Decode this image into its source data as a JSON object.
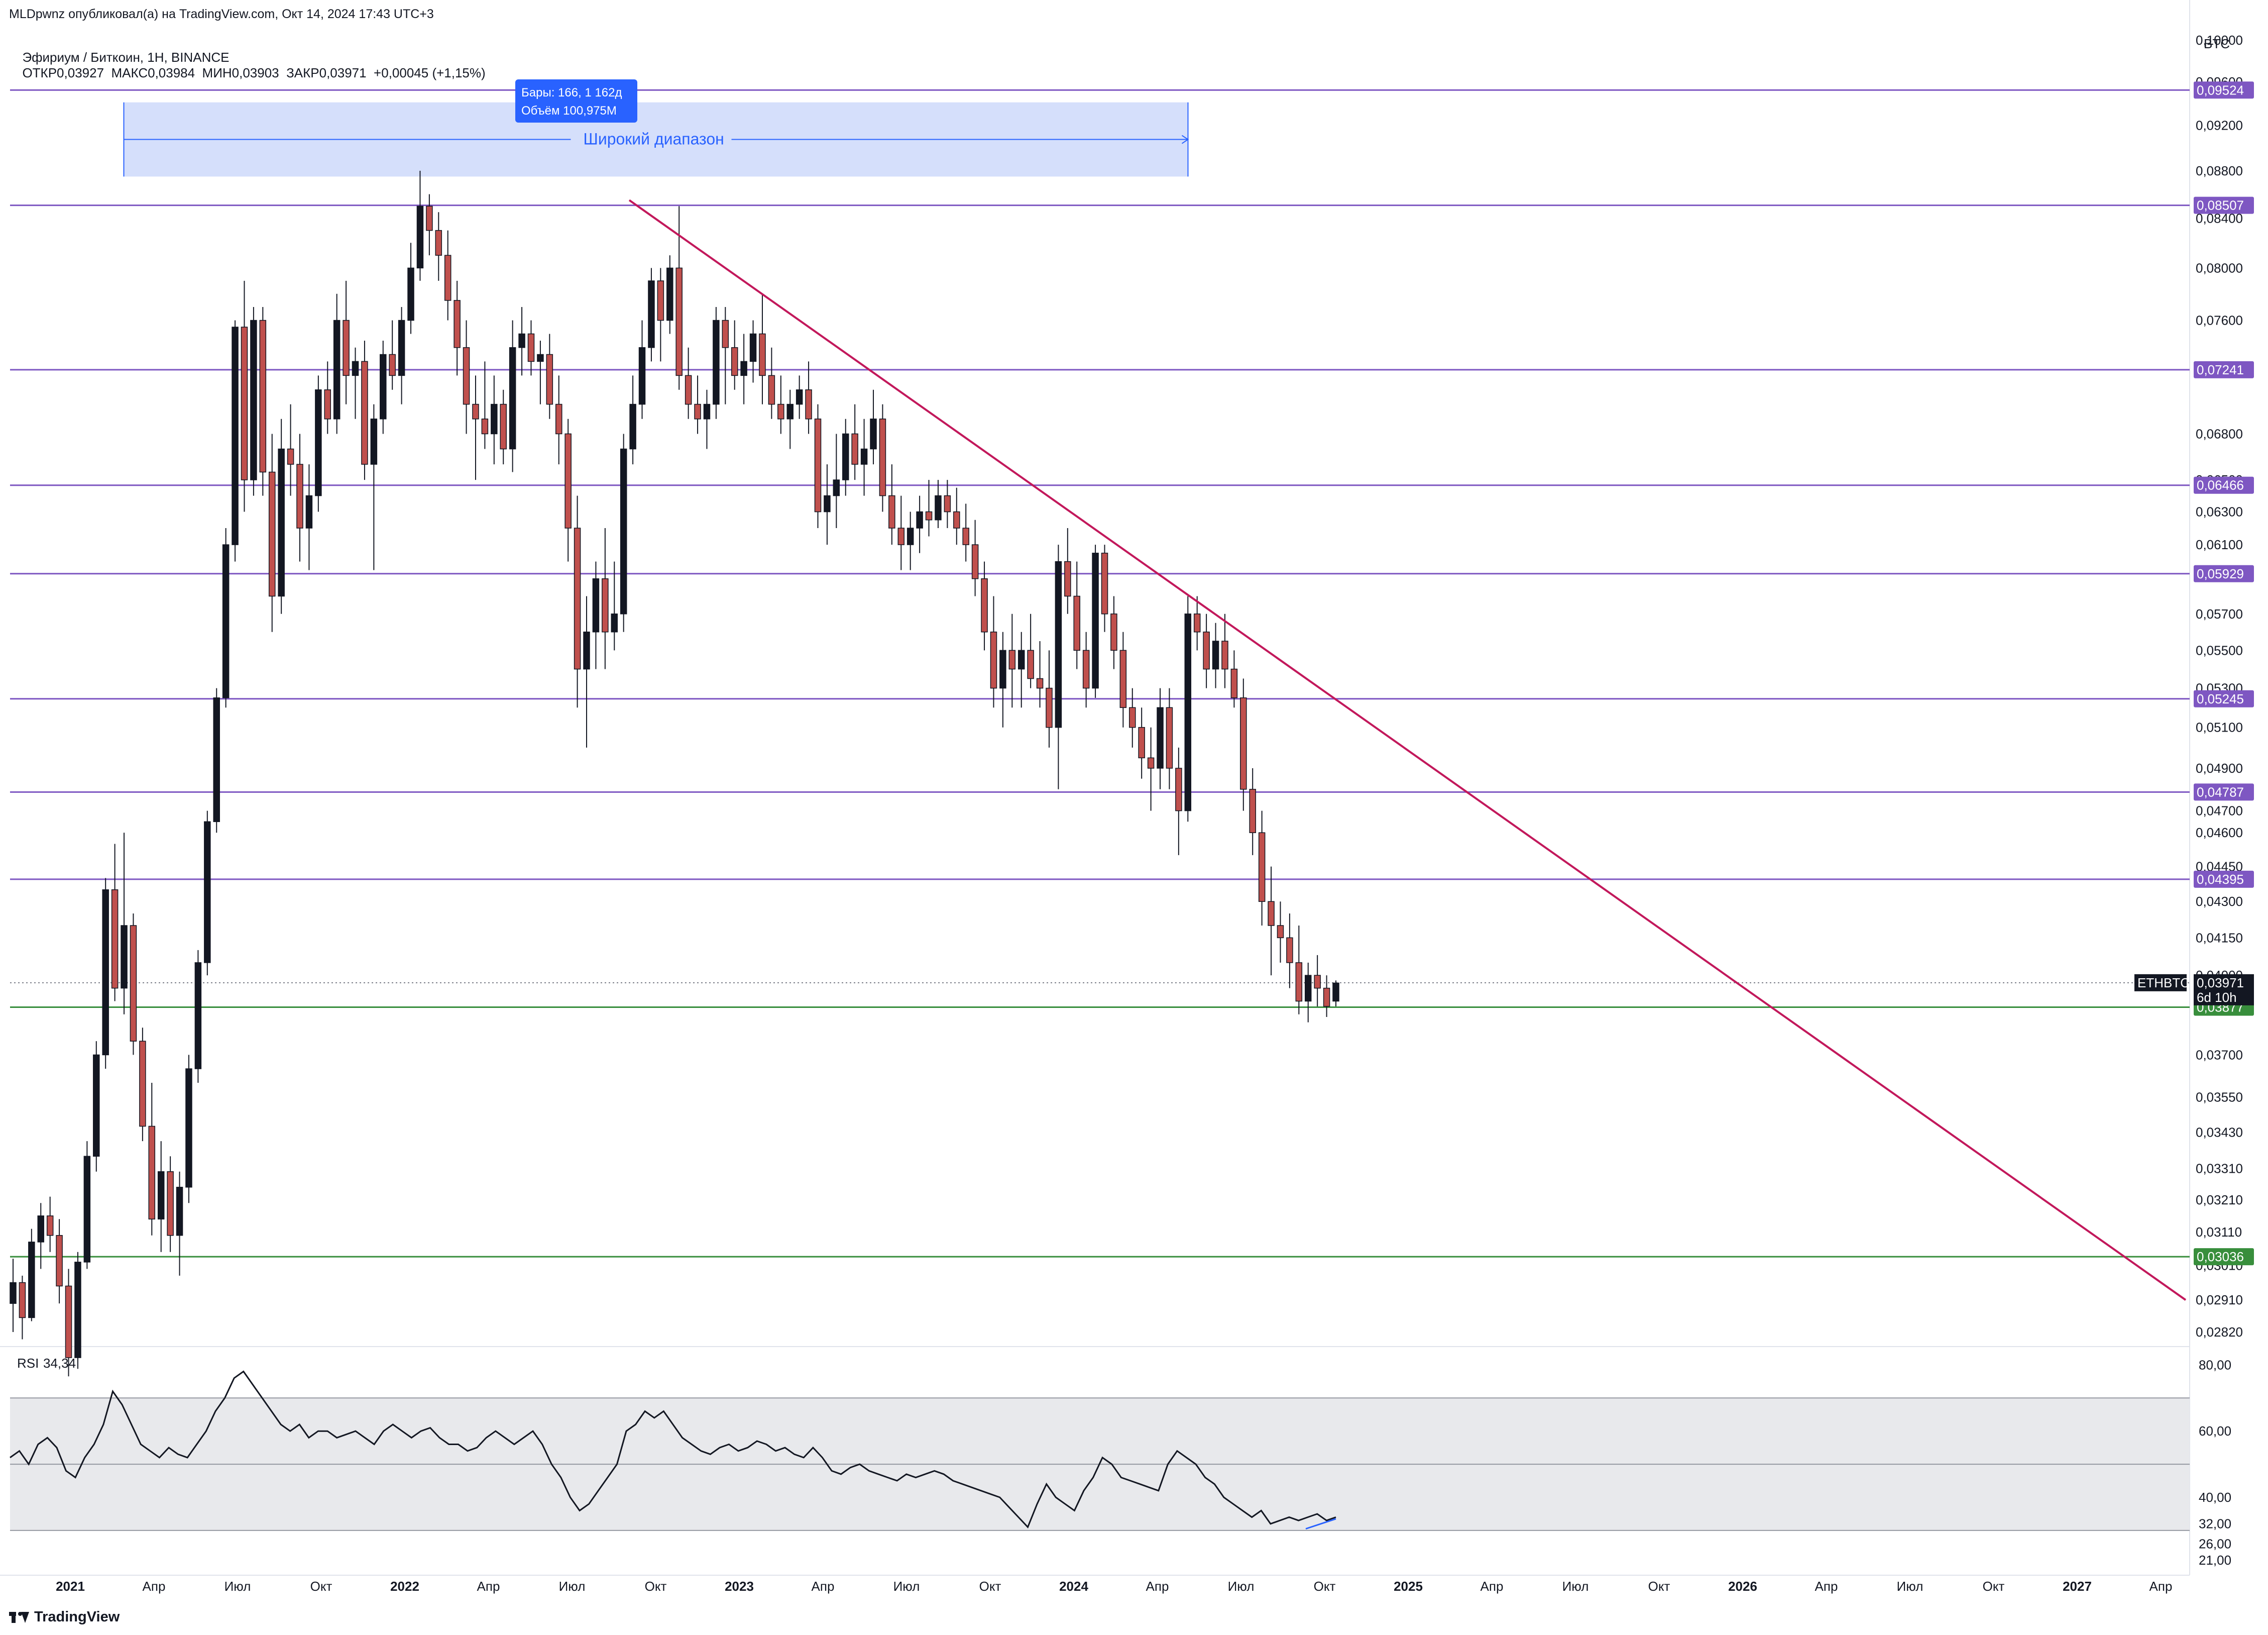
{
  "header": {
    "published": "MLDpwnz опубликовал(а) на TradingView.com, Окт 14, 2024 17:43 UTC+3"
  },
  "legend": {
    "symbol": "Эфириум / Биткоин, 1H, BINANCE",
    "ohlc": "ОТКР0,03927  МАКС0,03984  МИН0,03903  ЗАКР0,03971  +0,00045 (+1,15%)"
  },
  "currency": "BTC",
  "footer": {
    "logo_text": "TradingView"
  },
  "colors": {
    "up": "#131722",
    "down": "#c0504d",
    "purple": "#7e57c2",
    "green": "#388e3c",
    "trend": "#c2185b",
    "range_fill": "#d0dcfb",
    "range_box": "#2962ff"
  },
  "chart_data": {
    "type": "candlestick",
    "symbol": "ETHBTC",
    "price_axis": {
      "scale": "log",
      "ticks": [
        "0,10000",
        "0,09600",
        "0,09200",
        "0,08800",
        "0,08400",
        "0,08000",
        "0,07600",
        "0,06800",
        "0,06500",
        "0,06300",
        "0,06100",
        "0,05700",
        "0,05500",
        "0,05300",
        "0,05100",
        "0,04900",
        "0,04700",
        "0,04600",
        "0,04450",
        "0,04300",
        "0,04150",
        "0,04000",
        "0,03700",
        "0,03550",
        "0,03430",
        "0,03310",
        "0,03210",
        "0,03110",
        "0,03010",
        "0,02910",
        "0,02820"
      ],
      "range": [
        0.0278,
        0.102
      ]
    },
    "time_axis": {
      "labels": [
        "2021",
        "Апр",
        "Июл",
        "Окт",
        "2022",
        "Апр",
        "Июл",
        "Окт",
        "2023",
        "Апр",
        "Июл",
        "Окт",
        "2024",
        "Апр",
        "Июл",
        "Окт",
        "2025",
        "Апр",
        "Июл",
        "Окт",
        "2026",
        "Апр",
        "Июл",
        "Окт",
        "2027",
        "Апр"
      ],
      "bold": [
        "2021",
        "2022",
        "2023",
        "2024",
        "2025",
        "2026",
        "2027"
      ]
    },
    "horizontal_levels": [
      {
        "price": 0.09524,
        "label": "0,09524",
        "color": "purple"
      },
      {
        "price": 0.08507,
        "label": "0,08507",
        "color": "purple"
      },
      {
        "price": 0.07241,
        "label": "0,07241",
        "color": "purple"
      },
      {
        "price": 0.06466,
        "label": "0,06466",
        "color": "purple"
      },
      {
        "price": 0.05929,
        "label": "0,05929",
        "color": "purple"
      },
      {
        "price": 0.05245,
        "label": "0,05245",
        "color": "purple"
      },
      {
        "price": 0.04787,
        "label": "0,04787",
        "color": "purple"
      },
      {
        "price": 0.04395,
        "label": "0,04395",
        "color": "purple"
      },
      {
        "price": 0.03877,
        "label": "0,03877",
        "color": "green"
      },
      {
        "price": 0.03036,
        "label": "0,03036",
        "color": "green"
      }
    ],
    "last_price": {
      "symbol": "ETHBTC",
      "price": "0,03971",
      "countdown": "6d 10h",
      "value": 0.03971
    },
    "trendline": {
      "from": {
        "time": "2022-09",
        "price": 0.0855
      },
      "to": {
        "time": "2027-05",
        "price": 0.0291
      }
    },
    "range_tool": {
      "label": "Широкий диапазон",
      "bars": "Бары: 166, 1 162д",
      "volume": "Объём 100,975M",
      "from_time": "2021-03",
      "to_time": "2024-05",
      "price_high": 0.0941,
      "price_low": 0.0875
    },
    "candles_weekly": [
      [
        0.029,
        0.0303,
        0.0282,
        0.0296
      ],
      [
        0.0296,
        0.0298,
        0.028,
        0.0286
      ],
      [
        0.0286,
        0.0312,
        0.0285,
        0.0308
      ],
      [
        0.0308,
        0.032,
        0.03,
        0.0316
      ],
      [
        0.0316,
        0.0322,
        0.0305,
        0.031
      ],
      [
        0.031,
        0.0315,
        0.029,
        0.0295
      ],
      [
        0.0295,
        0.03,
        0.027,
        0.0275
      ],
      [
        0.0275,
        0.0305,
        0.0272,
        0.0302
      ],
      [
        0.0302,
        0.034,
        0.03,
        0.0335
      ],
      [
        0.0335,
        0.0375,
        0.033,
        0.037
      ],
      [
        0.037,
        0.044,
        0.0365,
        0.0435
      ],
      [
        0.0435,
        0.0455,
        0.039,
        0.0395
      ],
      [
        0.0395,
        0.046,
        0.0385,
        0.042
      ],
      [
        0.042,
        0.0425,
        0.037,
        0.0375
      ],
      [
        0.0375,
        0.038,
        0.034,
        0.0345
      ],
      [
        0.0345,
        0.036,
        0.031,
        0.0315
      ],
      [
        0.0315,
        0.034,
        0.0305,
        0.033
      ],
      [
        0.033,
        0.0335,
        0.0305,
        0.031
      ],
      [
        0.031,
        0.033,
        0.0298,
        0.0325
      ],
      [
        0.0325,
        0.037,
        0.032,
        0.0365
      ],
      [
        0.0365,
        0.041,
        0.036,
        0.0405
      ],
      [
        0.0405,
        0.047,
        0.04,
        0.0465
      ],
      [
        0.0465,
        0.053,
        0.046,
        0.0525
      ],
      [
        0.0525,
        0.062,
        0.052,
        0.061
      ],
      [
        0.061,
        0.076,
        0.06,
        0.0755
      ],
      [
        0.0755,
        0.079,
        0.063,
        0.065
      ],
      [
        0.065,
        0.077,
        0.064,
        0.076
      ],
      [
        0.076,
        0.077,
        0.064,
        0.0655
      ],
      [
        0.0655,
        0.068,
        0.056,
        0.058
      ],
      [
        0.058,
        0.069,
        0.057,
        0.067
      ],
      [
        0.067,
        0.07,
        0.064,
        0.066
      ],
      [
        0.066,
        0.068,
        0.06,
        0.062
      ],
      [
        0.062,
        0.066,
        0.0595,
        0.064
      ],
      [
        0.064,
        0.072,
        0.063,
        0.071
      ],
      [
        0.071,
        0.073,
        0.068,
        0.069
      ],
      [
        0.069,
        0.078,
        0.068,
        0.076
      ],
      [
        0.076,
        0.079,
        0.07,
        0.072
      ],
      [
        0.072,
        0.074,
        0.069,
        0.073
      ],
      [
        0.073,
        0.0745,
        0.065,
        0.066
      ],
      [
        0.066,
        0.07,
        0.0595,
        0.069
      ],
      [
        0.069,
        0.0745,
        0.068,
        0.0735
      ],
      [
        0.0735,
        0.076,
        0.071,
        0.072
      ],
      [
        0.072,
        0.077,
        0.07,
        0.076
      ],
      [
        0.076,
        0.082,
        0.075,
        0.08
      ],
      [
        0.08,
        0.088,
        0.079,
        0.085
      ],
      [
        0.085,
        0.086,
        0.081,
        0.083
      ],
      [
        0.083,
        0.0845,
        0.079,
        0.081
      ],
      [
        0.081,
        0.083,
        0.076,
        0.0775
      ],
      [
        0.0775,
        0.079,
        0.072,
        0.074
      ],
      [
        0.074,
        0.076,
        0.068,
        0.07
      ],
      [
        0.07,
        0.072,
        0.065,
        0.069
      ],
      [
        0.069,
        0.073,
        0.067,
        0.068
      ],
      [
        0.068,
        0.072,
        0.066,
        0.07
      ],
      [
        0.07,
        0.071,
        0.066,
        0.067
      ],
      [
        0.067,
        0.076,
        0.0655,
        0.074
      ],
      [
        0.074,
        0.077,
        0.072,
        0.075
      ],
      [
        0.075,
        0.076,
        0.072,
        0.073
      ],
      [
        0.073,
        0.0745,
        0.07,
        0.0735
      ],
      [
        0.0735,
        0.075,
        0.069,
        0.07
      ],
      [
        0.07,
        0.072,
        0.066,
        0.068
      ],
      [
        0.068,
        0.069,
        0.06,
        0.062
      ],
      [
        0.062,
        0.064,
        0.052,
        0.054
      ],
      [
        0.054,
        0.058,
        0.05,
        0.056
      ],
      [
        0.056,
        0.06,
        0.054,
        0.059
      ],
      [
        0.059,
        0.062,
        0.054,
        0.056
      ],
      [
        0.056,
        0.06,
        0.055,
        0.057
      ],
      [
        0.057,
        0.068,
        0.056,
        0.067
      ],
      [
        0.067,
        0.072,
        0.066,
        0.07
      ],
      [
        0.07,
        0.076,
        0.069,
        0.074
      ],
      [
        0.074,
        0.08,
        0.073,
        0.079
      ],
      [
        0.079,
        0.08,
        0.073,
        0.076
      ],
      [
        0.076,
        0.081,
        0.075,
        0.08
      ],
      [
        0.08,
        0.085,
        0.071,
        0.072
      ],
      [
        0.072,
        0.074,
        0.069,
        0.07
      ],
      [
        0.07,
        0.072,
        0.068,
        0.069
      ],
      [
        0.069,
        0.071,
        0.067,
        0.07
      ],
      [
        0.07,
        0.077,
        0.069,
        0.076
      ],
      [
        0.076,
        0.077,
        0.07,
        0.074
      ],
      [
        0.074,
        0.076,
        0.071,
        0.072
      ],
      [
        0.072,
        0.075,
        0.07,
        0.073
      ],
      [
        0.073,
        0.076,
        0.0715,
        0.075
      ],
      [
        0.075,
        0.078,
        0.07,
        0.072
      ],
      [
        0.072,
        0.074,
        0.069,
        0.07
      ],
      [
        0.07,
        0.072,
        0.068,
        0.069
      ],
      [
        0.069,
        0.071,
        0.067,
        0.07
      ],
      [
        0.07,
        0.072,
        0.069,
        0.071
      ],
      [
        0.071,
        0.073,
        0.068,
        0.069
      ],
      [
        0.069,
        0.07,
        0.062,
        0.063
      ],
      [
        0.063,
        0.066,
        0.061,
        0.064
      ],
      [
        0.064,
        0.068,
        0.062,
        0.065
      ],
      [
        0.065,
        0.069,
        0.064,
        0.068
      ],
      [
        0.068,
        0.07,
        0.065,
        0.066
      ],
      [
        0.066,
        0.069,
        0.064,
        0.067
      ],
      [
        0.067,
        0.071,
        0.066,
        0.069
      ],
      [
        0.069,
        0.07,
        0.063,
        0.064
      ],
      [
        0.064,
        0.066,
        0.061,
        0.062
      ],
      [
        0.062,
        0.064,
        0.0595,
        0.061
      ],
      [
        0.061,
        0.063,
        0.0595,
        0.062
      ],
      [
        0.062,
        0.064,
        0.0605,
        0.063
      ],
      [
        0.063,
        0.065,
        0.0615,
        0.0625
      ],
      [
        0.0625,
        0.065,
        0.062,
        0.064
      ],
      [
        0.064,
        0.065,
        0.062,
        0.063
      ],
      [
        0.063,
        0.0645,
        0.061,
        0.062
      ],
      [
        0.062,
        0.0635,
        0.06,
        0.061
      ],
      [
        0.061,
        0.0625,
        0.058,
        0.059
      ],
      [
        0.059,
        0.06,
        0.055,
        0.056
      ],
      [
        0.056,
        0.058,
        0.052,
        0.053
      ],
      [
        0.053,
        0.056,
        0.051,
        0.055
      ],
      [
        0.055,
        0.057,
        0.052,
        0.054
      ],
      [
        0.054,
        0.056,
        0.052,
        0.055
      ],
      [
        0.055,
        0.057,
        0.053,
        0.0535
      ],
      [
        0.0535,
        0.0555,
        0.052,
        0.053
      ],
      [
        0.053,
        0.055,
        0.05,
        0.051
      ],
      [
        0.051,
        0.061,
        0.048,
        0.06
      ],
      [
        0.06,
        0.062,
        0.057,
        0.058
      ],
      [
        0.058,
        0.06,
        0.054,
        0.055
      ],
      [
        0.055,
        0.056,
        0.052,
        0.053
      ],
      [
        0.053,
        0.061,
        0.0525,
        0.0605
      ],
      [
        0.0605,
        0.061,
        0.056,
        0.057
      ],
      [
        0.057,
        0.058,
        0.054,
        0.055
      ],
      [
        0.055,
        0.056,
        0.051,
        0.052
      ],
      [
        0.052,
        0.053,
        0.05,
        0.051
      ],
      [
        0.051,
        0.052,
        0.0485,
        0.0495
      ],
      [
        0.0495,
        0.051,
        0.047,
        0.049
      ],
      [
        0.049,
        0.053,
        0.048,
        0.052
      ],
      [
        0.052,
        0.053,
        0.048,
        0.049
      ],
      [
        0.049,
        0.05,
        0.045,
        0.047
      ],
      [
        0.047,
        0.058,
        0.0465,
        0.057
      ],
      [
        0.057,
        0.058,
        0.055,
        0.056
      ],
      [
        0.056,
        0.057,
        0.053,
        0.054
      ],
      [
        0.054,
        0.0565,
        0.053,
        0.0555
      ],
      [
        0.0555,
        0.057,
        0.053,
        0.054
      ],
      [
        0.054,
        0.055,
        0.052,
        0.0525
      ],
      [
        0.0525,
        0.0535,
        0.047,
        0.048
      ],
      [
        0.048,
        0.049,
        0.045,
        0.046
      ],
      [
        0.046,
        0.047,
        0.042,
        0.043
      ],
      [
        0.043,
        0.0445,
        0.04,
        0.042
      ],
      [
        0.042,
        0.043,
        0.0405,
        0.0415
      ],
      [
        0.0415,
        0.0425,
        0.0395,
        0.0405
      ],
      [
        0.0405,
        0.042,
        0.0385,
        0.039
      ],
      [
        0.039,
        0.0405,
        0.0382,
        0.04
      ],
      [
        0.04,
        0.0408,
        0.0388,
        0.0395
      ],
      [
        0.0395,
        0.04,
        0.0384,
        0.0388
      ],
      [
        0.039,
        0.0398,
        0.0388,
        0.0397
      ]
    ],
    "rsi": {
      "label": "RSI",
      "value": "34,34",
      "ticks": [
        "80,00",
        "60,00",
        "40,00",
        "32,00",
        "26,00",
        "21,00"
      ],
      "upper_band": 70,
      "lower_band": 30,
      "series": [
        52,
        54,
        50,
        56,
        58,
        55,
        48,
        46,
        52,
        56,
        62,
        72,
        68,
        62,
        56,
        54,
        52,
        55,
        53,
        52,
        56,
        60,
        66,
        70,
        76,
        78,
        74,
        70,
        66,
        62,
        60,
        62,
        58,
        60,
        60,
        58,
        59,
        60,
        58,
        56,
        60,
        62,
        60,
        58,
        60,
        61,
        58,
        56,
        56,
        54,
        55,
        58,
        60,
        58,
        56,
        58,
        60,
        56,
        50,
        46,
        40,
        36,
        38,
        42,
        46,
        50,
        60,
        62,
        66,
        64,
        66,
        62,
        58,
        56,
        54,
        53,
        55,
        56,
        54,
        55,
        57,
        56,
        54,
        55,
        53,
        52,
        55,
        52,
        48,
        47,
        49,
        50,
        48,
        47,
        46,
        45,
        47,
        46,
        47,
        48,
        47,
        45,
        44,
        43,
        42,
        41,
        40,
        37,
        34,
        31,
        38,
        44,
        40,
        38,
        36,
        42,
        46,
        52,
        50,
        46,
        45,
        44,
        43,
        42,
        50,
        54,
        52,
        50,
        46,
        44,
        40,
        38,
        36,
        34,
        36,
        32,
        33,
        34,
        33,
        34,
        35,
        33,
        34
      ]
    }
  }
}
